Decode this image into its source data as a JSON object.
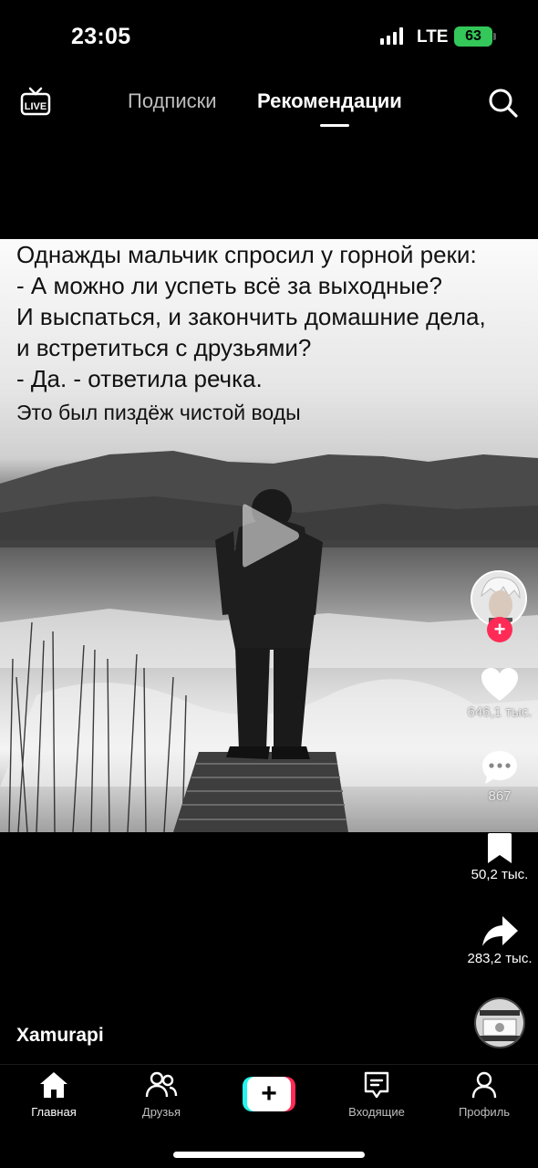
{
  "status_bar": {
    "time": "23:05",
    "network": "LTE",
    "battery": "63"
  },
  "top_nav": {
    "live_icon": "live-tv-icon",
    "tabs": [
      {
        "label": "Подписки",
        "active": false
      },
      {
        "label": "Рекомендации",
        "active": true
      }
    ],
    "search_icon": "search-icon"
  },
  "video": {
    "overlay_lines": [
      "Однажды мальчик спросил у горной реки:",
      "- А можно ли успеть всё за выходные?",
      "И выспаться, и закончить домашние дела,",
      "и встретиться с друзьями?",
      "- Да. - ответила речка."
    ],
    "punchline": "Это был пиздёж чистой воды",
    "play_icon": "play-icon"
  },
  "actions": {
    "likes": "646,1 тыс.",
    "comments": "867",
    "saves": "50,2 тыс.",
    "shares": "283,2 тыс."
  },
  "author": "Xamurapi",
  "bottom_nav": {
    "items": [
      {
        "label": "Главная",
        "icon": "home-icon"
      },
      {
        "label": "Друзья",
        "icon": "friends-icon"
      },
      {
        "label": "",
        "icon": "create-plus-icon"
      },
      {
        "label": "Входящие",
        "icon": "inbox-icon"
      },
      {
        "label": "Профиль",
        "icon": "profile-icon"
      }
    ]
  },
  "colors": {
    "accent_red": "#fe2c55",
    "accent_cyan": "#25f4ee",
    "battery_green": "#34c759"
  }
}
